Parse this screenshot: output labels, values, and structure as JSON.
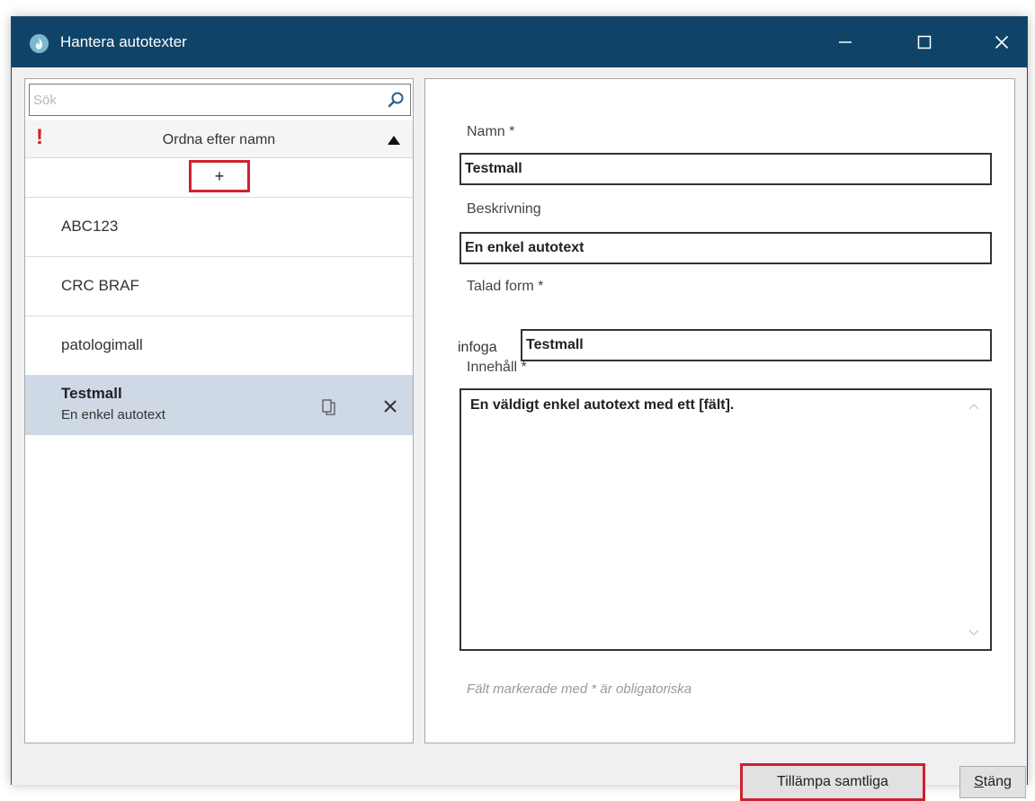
{
  "window": {
    "title": "Hantera autotexter",
    "app_icon": "flame-icon",
    "minimize_icon": "minimize-icon",
    "maximize_icon": "maximize-icon",
    "close_icon": "close-icon"
  },
  "colors": {
    "titlebar": "#0f4468",
    "selected_row": "#cfd9e6",
    "highlight_red": "#d1202e",
    "required_mark": "#d42020"
  },
  "sidebar": {
    "search_placeholder": "Sök",
    "search_icon": "search-icon",
    "sort_indicator": "!",
    "sort_label": "Ordna efter namn",
    "sort_icon": "triangle-up-icon",
    "add_label": "+",
    "items": [
      {
        "name": "ABC123"
      },
      {
        "name": "CRC BRAF"
      },
      {
        "name": "patologimall"
      },
      {
        "name": "Testmall",
        "description": "En enkel autotext",
        "selected": true
      }
    ],
    "copy_icon": "copy-icon",
    "delete_icon": "delete-icon"
  },
  "form": {
    "name_label": "Namn *",
    "name_value": "Testmall",
    "description_label": "Beskrivning",
    "description_value": "En enkel autotext",
    "spoken_label": "Talad form *",
    "spoken_prefix": "infoga",
    "spoken_value": "Testmall",
    "content_label": "Innehåll *",
    "content_value": "En väldigt enkel autotext med ett [fält].",
    "required_note": "Fält markerade med * är obligatoriska"
  },
  "footer": {
    "apply_label": "Tillämpa samtliga",
    "close_mnemonic": "S",
    "close_rest": "täng"
  }
}
